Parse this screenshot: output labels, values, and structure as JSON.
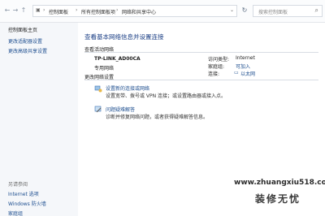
{
  "address_bar": {
    "crumbs": [
      "控制面板",
      "所有控制面板项",
      "网络和共享中心"
    ],
    "search_placeholder": "搜索控制面板"
  },
  "sidebar": {
    "home": "控制面板主页",
    "links": [
      "更改适配器设置",
      "更改高级共享设置"
    ],
    "see_also_title": "另请参阅",
    "see_also": [
      "Internet 选项",
      "Windows 防火墙",
      "家庭组"
    ]
  },
  "main": {
    "title": "查看基本网络信息并设置连接",
    "active_section": "查看活动网络",
    "network": {
      "name": "TP-LINK_AD00CA",
      "type": "专用网络",
      "access_type_label": "访问类型:",
      "access_type_value": "Internet",
      "homegroup_label": "家庭组:",
      "homegroup_value": "可加入",
      "connections_label": "连接:",
      "connections_value": "以太网"
    },
    "change_section": "更改网络设置",
    "tasks": [
      {
        "link": "设置新的连接或网络",
        "desc": "设置宽带、拨号或 VPN 连接；或设置路由器或接入点。"
      },
      {
        "link": "问题疑难解答",
        "desc": "诊断并修复网络问题，或者获得疑难解答信息。"
      }
    ]
  },
  "watermark": {
    "url": "www.zhuangxiu518.com",
    "text": "装修无忧"
  }
}
